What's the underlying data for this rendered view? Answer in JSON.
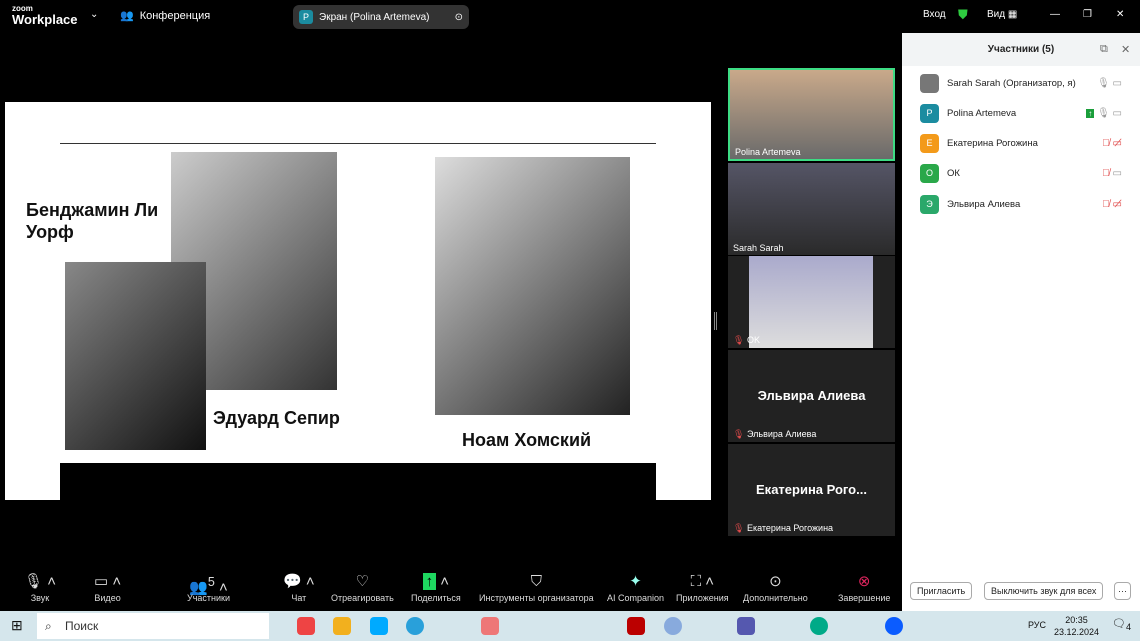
{
  "titlebar": {
    "logo_small": "zoom",
    "logo_big": "Workplace",
    "meeting_label": "Конференция",
    "share_badge": "P",
    "share_label": "Экран (Polina Artemeva)",
    "signin": "Вход",
    "view": "Вид"
  },
  "slide": {
    "name1": "Бенджамин Ли Уорф",
    "name2": "Эдуард Сепир",
    "name3": "Ноам Хомский"
  },
  "videos": [
    {
      "label": "Polina Artemeva"
    },
    {
      "label": "Sarah Sarah"
    },
    {
      "label": "OK"
    },
    {
      "title": "Эльвира Алиева",
      "label": "Эльвира Алиева"
    },
    {
      "title": "Екатерина Рого...",
      "label": "Екатерина Рогожина"
    }
  ],
  "participants": {
    "title": "Участники (5)",
    "items": [
      {
        "initial": "",
        "name": "Sarah Sarah (Организатор, я)",
        "color": "#777",
        "mic_muted": false,
        "cam_off": false
      },
      {
        "initial": "P",
        "name": "Polina Artemeva",
        "color": "#1b8ca0",
        "mic_muted": false,
        "cam_off": false
      },
      {
        "initial": "Е",
        "name": "Екатерина Рогожина",
        "color": "#f39a1a",
        "mic_muted": true,
        "cam_off": true
      },
      {
        "initial": "О",
        "name": "ОК",
        "color": "#2aa84a",
        "mic_muted": true,
        "cam_off": false
      },
      {
        "initial": "Э",
        "name": "Эльвира Алиева",
        "color": "#2aa86a",
        "mic_muted": true,
        "cam_off": true
      }
    ],
    "invite": "Пригласить",
    "mute_all": "Выключить звук для всех",
    "more": "···"
  },
  "toolbar": {
    "audio": "Звук",
    "video": "Видео",
    "participants": "Участники",
    "participants_count": "5",
    "chat": "Чат",
    "react": "Отреагировать",
    "share": "Поделиться",
    "host_tools": "Инструменты организатора",
    "ai": "AI Companion",
    "apps": "Приложения",
    "more": "Дополнительно",
    "end": "Завершение"
  },
  "taskbar": {
    "search": "Поиск",
    "lang": "РУС",
    "time": "20:35",
    "date": "23.12.2024",
    "notif": "4"
  }
}
